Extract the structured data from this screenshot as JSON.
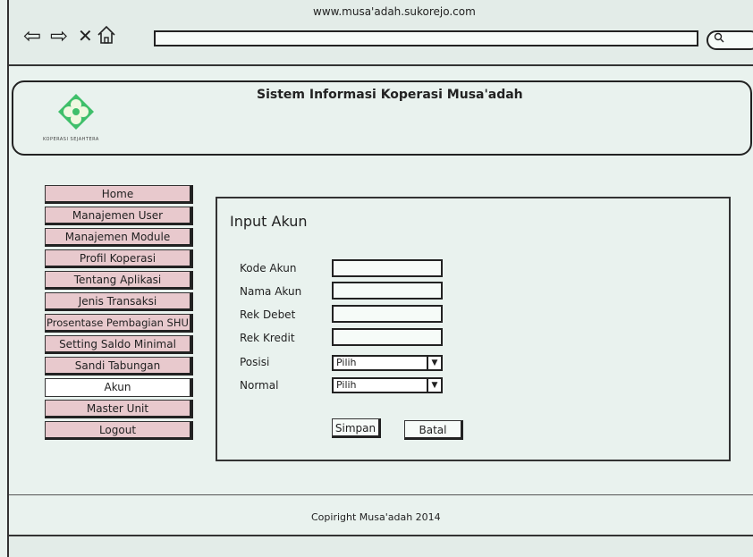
{
  "browser": {
    "url": "www.musa'adah.sukorejo.com",
    "back_icon": "arrow-left-icon",
    "forward_icon": "arrow-right-icon",
    "close_icon": "close-icon",
    "home_icon": "home-icon",
    "search_icon": "search-icon"
  },
  "header": {
    "title": "Sistem Informasi Koperasi Musa'adah",
    "logo_text": "KOPERASI SEJAHTERA"
  },
  "sidebar": {
    "items": [
      {
        "label": "Home"
      },
      {
        "label": "Manajemen User"
      },
      {
        "label": "Manajemen Module"
      },
      {
        "label": "Profil Koperasi"
      },
      {
        "label": "Tentang Aplikasi"
      },
      {
        "label": "Jenis Transaksi"
      },
      {
        "label": "Prosentase Pembagian SHU"
      },
      {
        "label": "Setting Saldo Minimal"
      },
      {
        "label": "Sandi Tabungan"
      },
      {
        "label": "Akun"
      },
      {
        "label": "Master Unit"
      },
      {
        "label": "Logout"
      }
    ],
    "active_index": 9
  },
  "form": {
    "title": "Input Akun",
    "fields": [
      {
        "label": "Kode Akun",
        "value": ""
      },
      {
        "label": "Nama Akun",
        "value": ""
      },
      {
        "label": "Rek Debet",
        "value": ""
      },
      {
        "label": "Rek Kredit",
        "value": ""
      }
    ],
    "posisi": {
      "label": "Posisi",
      "selected": "Pilih"
    },
    "normal": {
      "label": "Normal",
      "selected": "Pilih"
    },
    "save_label": "Simpan",
    "cancel_label": "Batal"
  },
  "footer": {
    "text": "Copiright Musa'adah 2014"
  },
  "colors": {
    "background": "#e9f2ee",
    "menu_item": "#e8c9cd",
    "menu_active": "#ffffff",
    "logo_green": "#3fbf6a"
  }
}
